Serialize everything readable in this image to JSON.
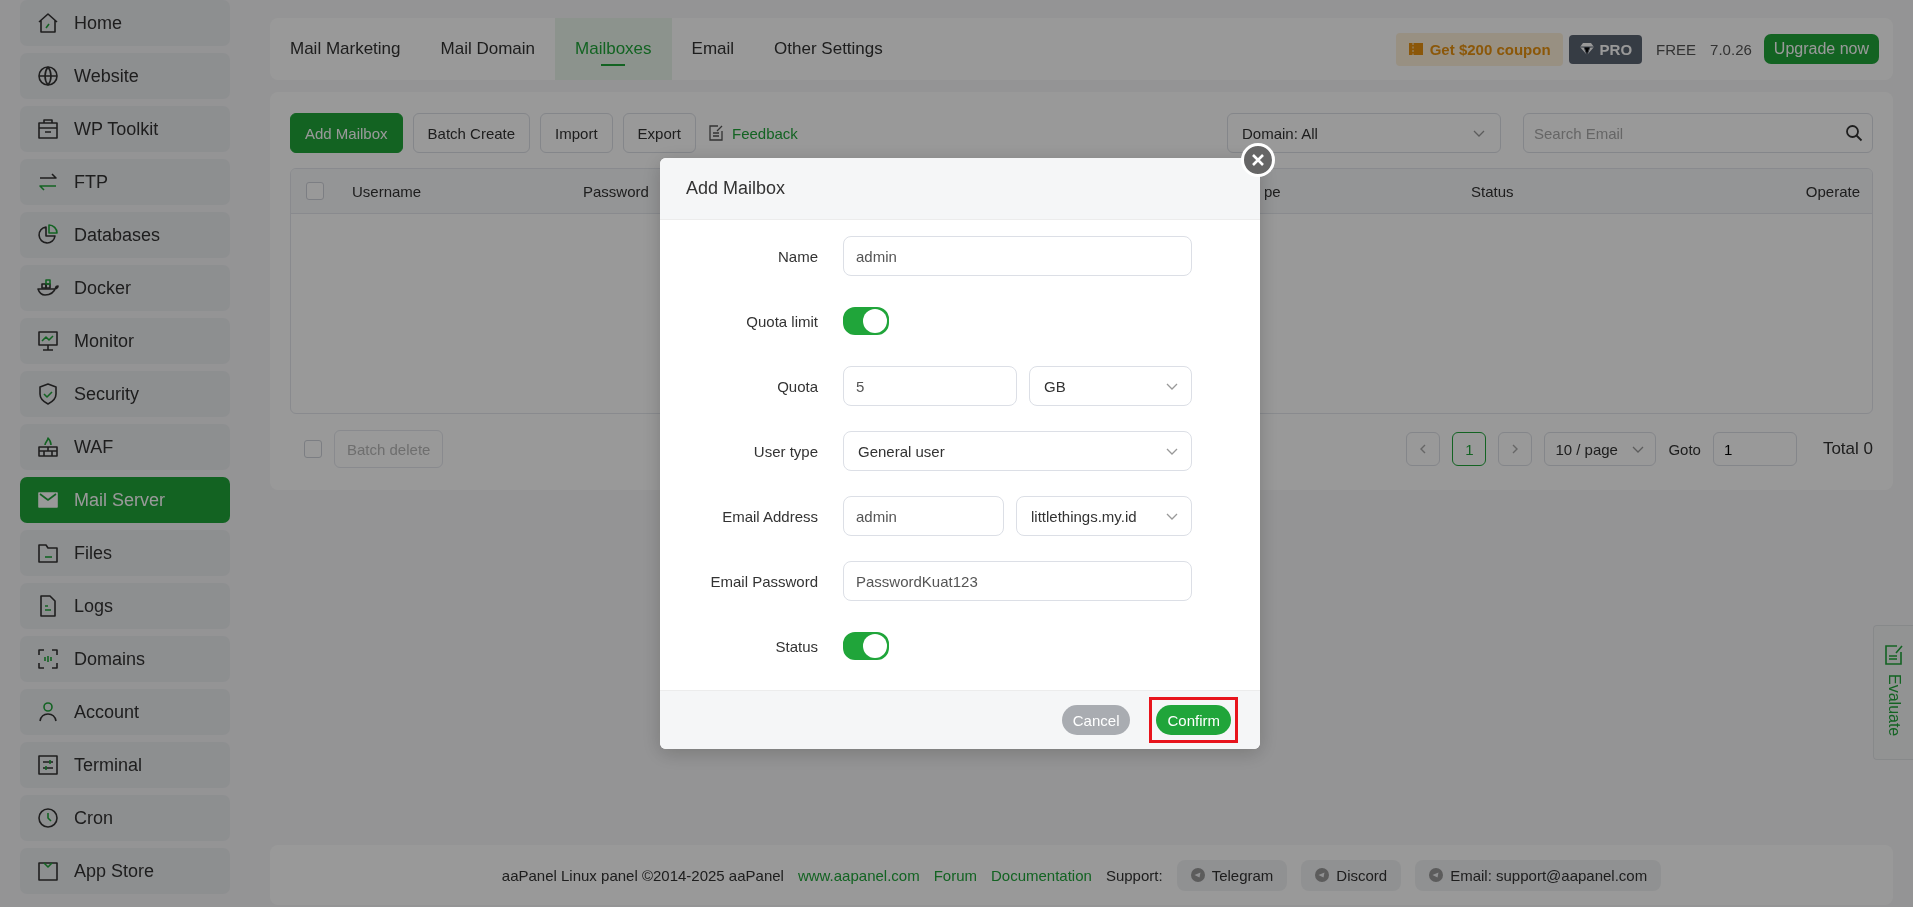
{
  "sidebar": {
    "items": [
      {
        "label": "Home",
        "selected": false
      },
      {
        "label": "Website",
        "selected": false
      },
      {
        "label": "WP Toolkit",
        "selected": false
      },
      {
        "label": "FTP",
        "selected": false
      },
      {
        "label": "Databases",
        "selected": false
      },
      {
        "label": "Docker",
        "selected": false
      },
      {
        "label": "Monitor",
        "selected": false
      },
      {
        "label": "Security",
        "selected": false
      },
      {
        "label": "WAF",
        "selected": false
      },
      {
        "label": "Mail Server",
        "selected": true
      },
      {
        "label": "Files",
        "selected": false
      },
      {
        "label": "Logs",
        "selected": false
      },
      {
        "label": "Domains",
        "selected": false
      },
      {
        "label": "Account",
        "selected": false
      },
      {
        "label": "Terminal",
        "selected": false
      },
      {
        "label": "Cron",
        "selected": false
      },
      {
        "label": "App Store",
        "selected": false
      }
    ]
  },
  "tabs": [
    {
      "label": "Mail Marketing",
      "selected": false
    },
    {
      "label": "Mail Domain",
      "selected": false
    },
    {
      "label": "Mailboxes",
      "selected": true
    },
    {
      "label": "Email",
      "selected": false
    },
    {
      "label": "Other Settings",
      "selected": false
    }
  ],
  "promo": {
    "coupon": "Get $200 coupon",
    "pro": "PRO",
    "plan": "FREE",
    "version": "7.0.26",
    "upgrade": "Upgrade now"
  },
  "toolbar": {
    "buttons": [
      {
        "label": "Add Mailbox",
        "primary": true
      },
      {
        "label": "Batch Create",
        "primary": false
      },
      {
        "label": "Import",
        "primary": false
      },
      {
        "label": "Export",
        "primary": false
      }
    ],
    "feedback": "Feedback",
    "domain_filter": "Domain: All",
    "search": {
      "placeholder": "Search Email"
    }
  },
  "table": {
    "select_all_checked": false,
    "columns": [
      "Username",
      "Password",
      "pe",
      "Status",
      "Operate"
    ]
  },
  "bulk": {
    "checked": false,
    "button": "Batch delete",
    "disabled": true
  },
  "pagination": {
    "pages": [
      {
        "label": "1",
        "selected": true
      }
    ],
    "page_size": "10 / page",
    "goto_label": "Goto",
    "goto_value": "1",
    "total": "Total 0"
  },
  "footer": {
    "copyright": "aaPanel Linux panel ©2014-2025 aaPanel",
    "links": [
      "www.aapanel.com",
      "Forum",
      "Documentation"
    ],
    "support_label": "Support:",
    "support": [
      "Telegram",
      "Discord",
      "Email: support@aapanel.com"
    ]
  },
  "evaluate": "Evaluate",
  "dialog": {
    "title": "Add Mailbox",
    "fields": [
      {
        "kind": "text",
        "label": "Name",
        "value": "admin"
      },
      {
        "kind": "switch",
        "label": "Quota limit",
        "on": true
      },
      {
        "kind": "number-unit",
        "label": "Quota",
        "value": "5",
        "option": "GB"
      },
      {
        "kind": "select",
        "label": "User type",
        "option": "General user"
      },
      {
        "kind": "name-domain",
        "label": "Email Address",
        "value": "admin",
        "option": "littlethings.my.id"
      },
      {
        "kind": "text",
        "label": "Email Password",
        "value": "PasswordKuat123"
      },
      {
        "kind": "switch",
        "label": "Status",
        "on": true
      }
    ],
    "buttons": [
      {
        "kind": "cancel",
        "label": "Cancel",
        "highlighted": false
      },
      {
        "kind": "confirm",
        "label": "Confirm",
        "highlighted": true
      }
    ]
  }
}
